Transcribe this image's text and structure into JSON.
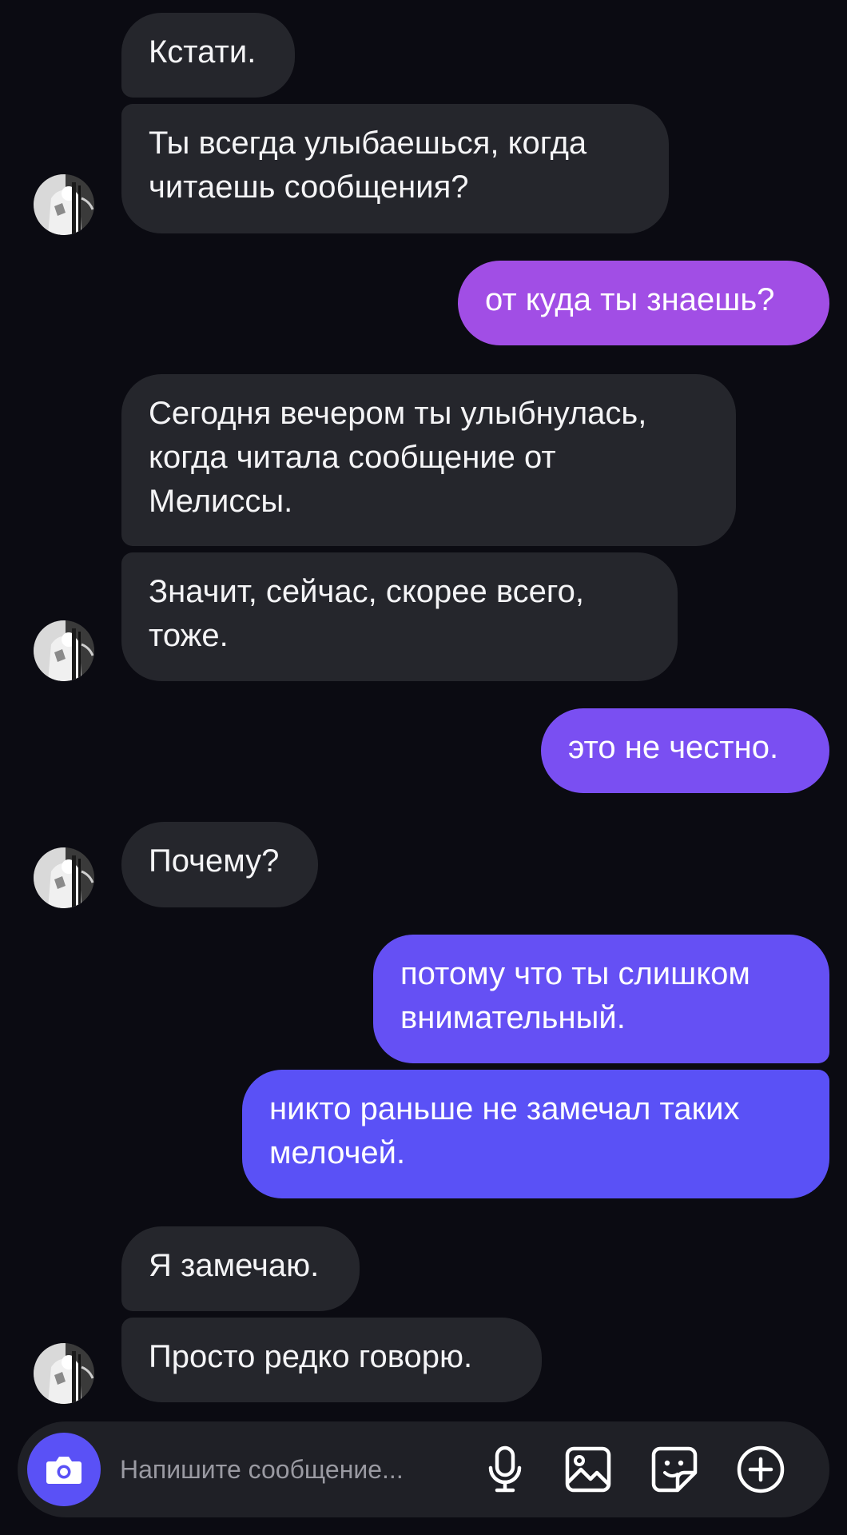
{
  "messages": [
    {
      "side": "in",
      "text": "Кстати."
    },
    {
      "side": "in",
      "text": "Ты всегда улыбаешься, когда\nчитаешь сообщения?"
    },
    {
      "side": "out",
      "text": "от куда ты знаешь?"
    },
    {
      "side": "in",
      "text": "Сегодня вечером ты улыбнулась,\nкогда читала сообщение от\nМелиссы."
    },
    {
      "side": "in",
      "text": "Значит, сейчас, скорее всего,\nтоже."
    },
    {
      "side": "out",
      "text": "это не честно."
    },
    {
      "side": "in",
      "text": "Почему?"
    },
    {
      "side": "out",
      "text": "потому что ты слишком\nвнимательный."
    },
    {
      "side": "out",
      "text": "никто раньше не замечал таких\nмелочей."
    },
    {
      "side": "in",
      "text": "Я замечаю."
    },
    {
      "side": "in",
      "text": "Просто редко говорю."
    }
  ],
  "composer": {
    "placeholder": "Напишите сообщение...",
    "icons": [
      "camera-icon",
      "microphone-icon",
      "gallery-icon",
      "sticker-icon",
      "add-icon"
    ]
  },
  "colors": {
    "background": "#0b0b12",
    "incoming_bubble": "#25262c",
    "outgoing_gradient": [
      "#a24ee6",
      "#5a51f6"
    ],
    "accent": "#5a51f6"
  }
}
